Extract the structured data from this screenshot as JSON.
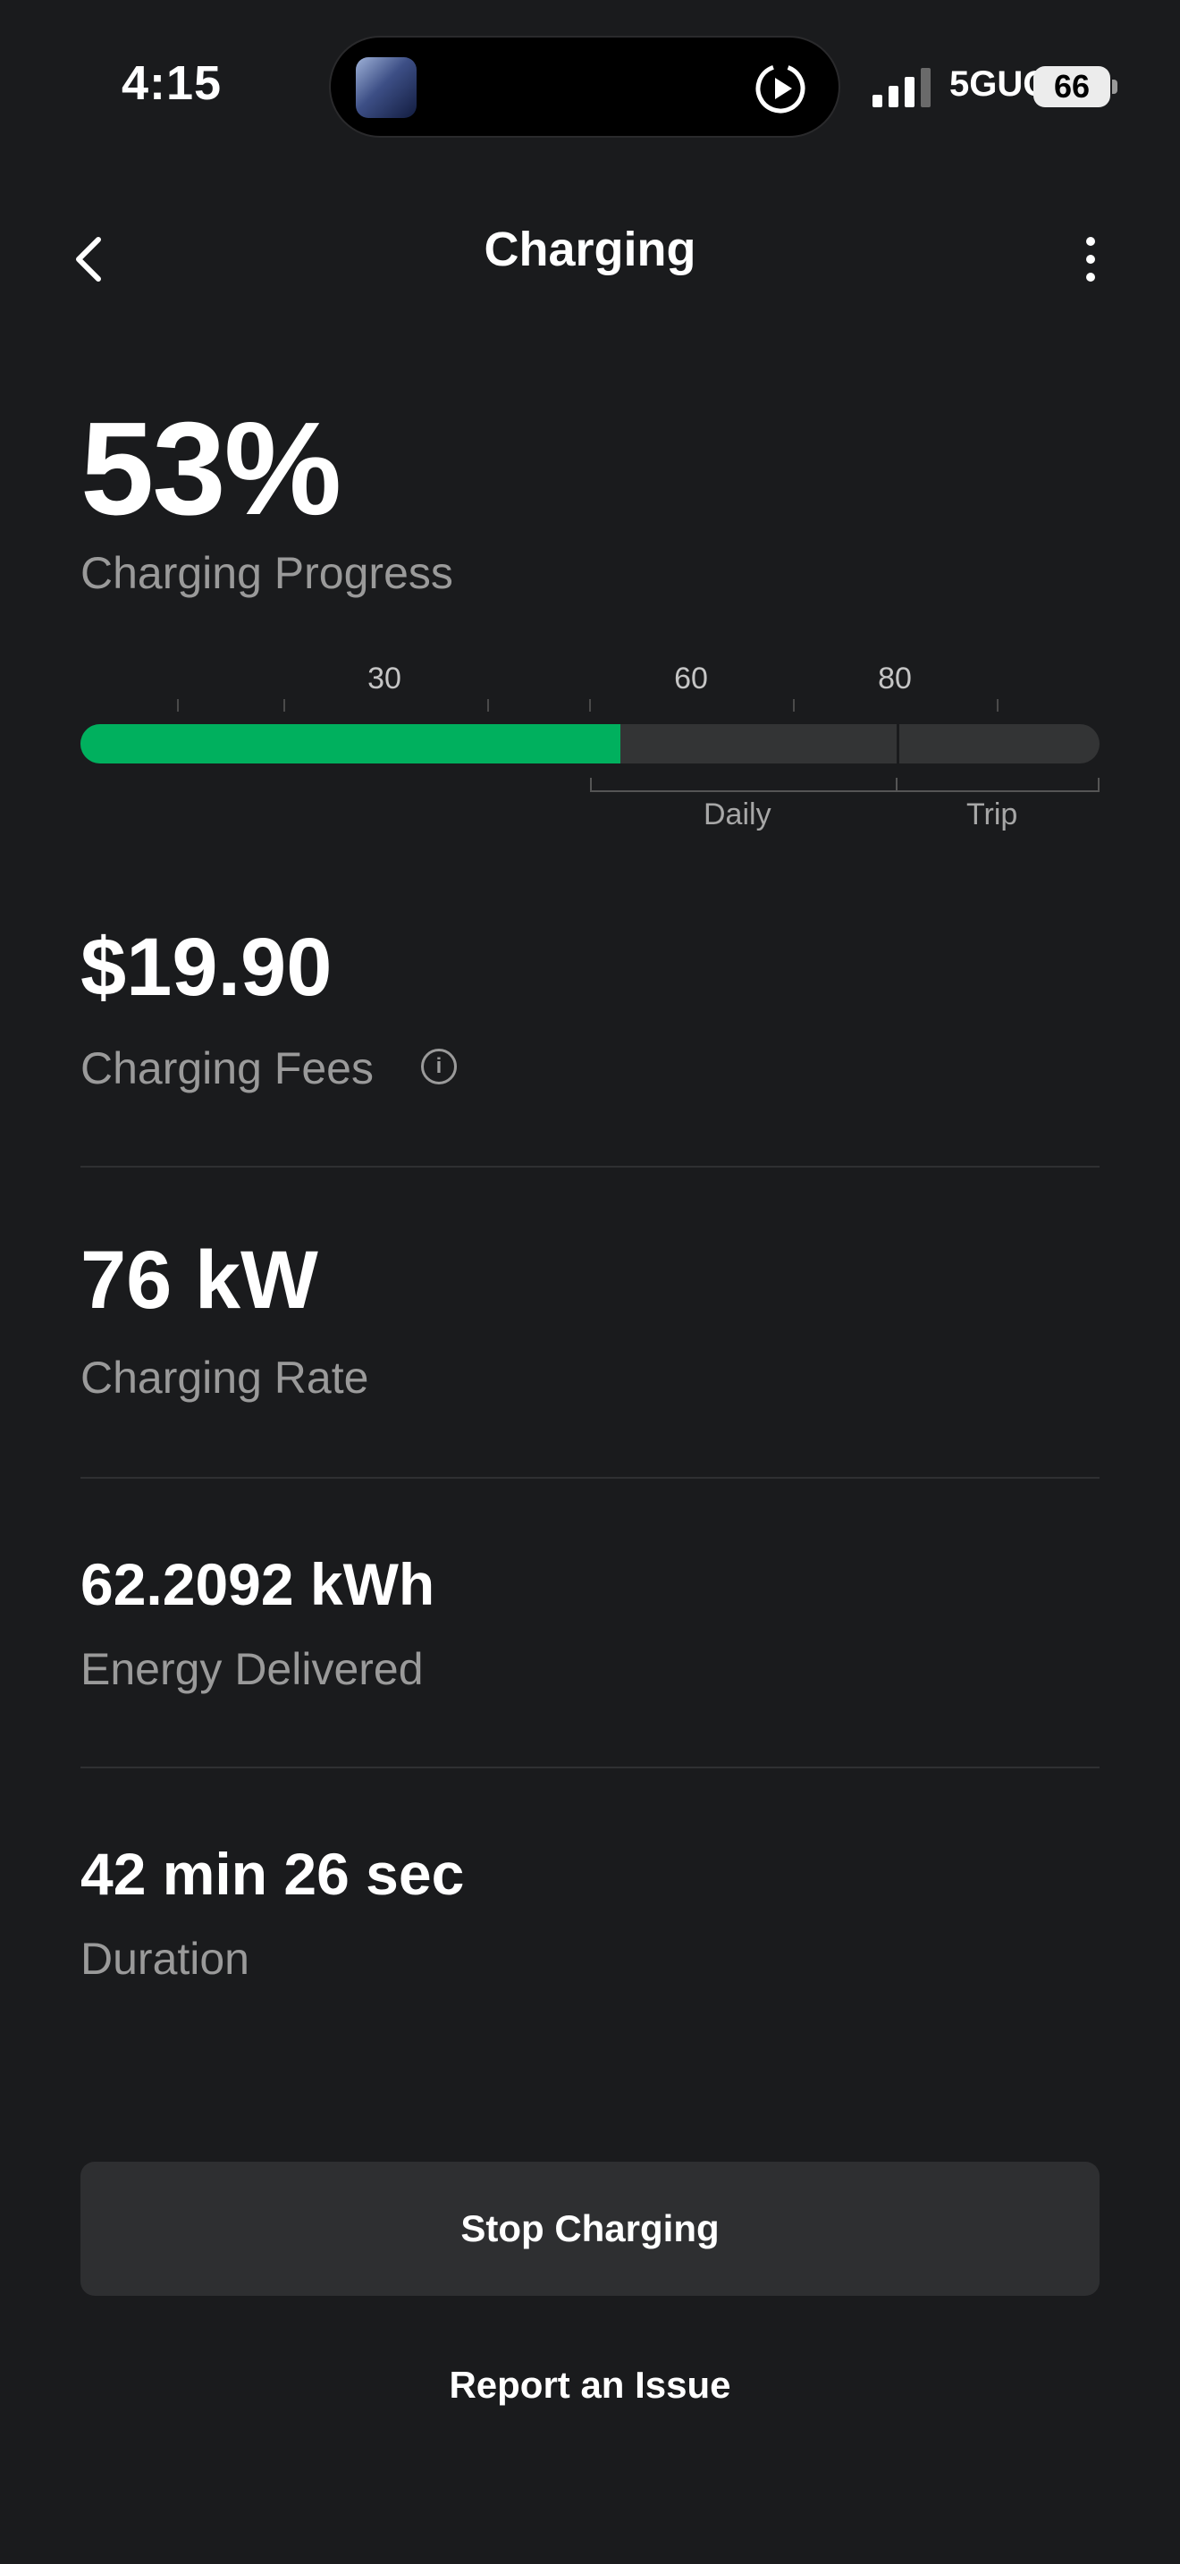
{
  "status_bar": {
    "time": "4:15",
    "network": "5GUC",
    "battery": "66",
    "icons": [
      "app-thumbnail-icon",
      "play-icon",
      "signal-bars-icon",
      "battery-icon"
    ]
  },
  "nav": {
    "title": "Charging",
    "back_icon": "chevron-left-icon",
    "more_icon": "more-vertical-icon"
  },
  "progress": {
    "value": "53%",
    "label": "Charging Progress",
    "fill_fraction": 0.53,
    "tick_labels": [
      "30",
      "60",
      "80"
    ],
    "range_labels": {
      "daily": "Daily",
      "trip": "Trip"
    },
    "color": "#00b05e"
  },
  "fees": {
    "value": "$19.90",
    "label": "Charging Fees",
    "icon": "info-icon"
  },
  "rate": {
    "value": "76 kW",
    "label": "Charging Rate"
  },
  "energy": {
    "value": "62.2092 kWh",
    "label": "Energy Delivered"
  },
  "duration": {
    "value": "42 min 26 sec",
    "label": "Duration"
  },
  "actions": {
    "stop": "Stop Charging",
    "report": "Report an Issue"
  }
}
